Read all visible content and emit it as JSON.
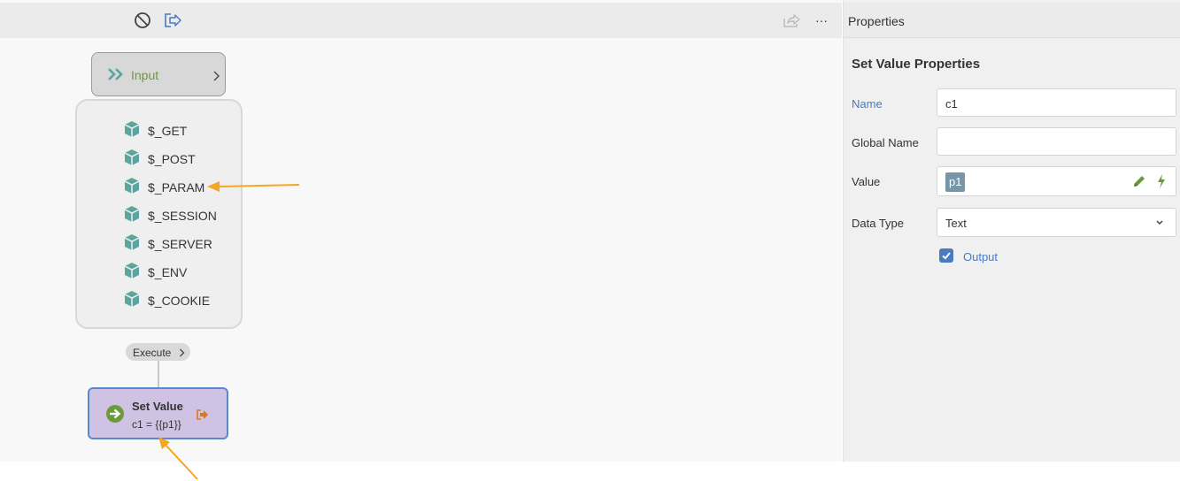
{
  "canvas": {
    "toolbar": {
      "disable_icon": "disable-icon",
      "exit_icon": "exit-icon",
      "share_icon": "share-icon",
      "more_label": "···"
    },
    "input_node": {
      "label": "Input"
    },
    "globals": [
      {
        "label": "$_GET"
      },
      {
        "label": "$_POST"
      },
      {
        "label": "$_PARAM"
      },
      {
        "label": "$_SESSION"
      },
      {
        "label": "$_SERVER"
      },
      {
        "label": "$_ENV"
      },
      {
        "label": "$_COOKIE"
      }
    ],
    "execute_label": "Execute",
    "set_value_node": {
      "title": "Set Value",
      "expression": "c1 = {{p1}}"
    }
  },
  "properties": {
    "header": "Properties",
    "title": "Set Value Properties",
    "fields": {
      "name": {
        "label": "Name",
        "value": "c1"
      },
      "global_name": {
        "label": "Global Name",
        "value": ""
      },
      "value": {
        "label": "Value",
        "chip": "p1"
      },
      "data_type": {
        "label": "Data Type",
        "selected": "Text"
      }
    },
    "output": {
      "label": "Output",
      "checked": true
    }
  },
  "colors": {
    "accent": "#4a7ac0",
    "node_purple": "#cfc2e3",
    "arrow": "#f5a623",
    "cube": "#5aa5a0",
    "input_green": "#6b9a3a"
  }
}
